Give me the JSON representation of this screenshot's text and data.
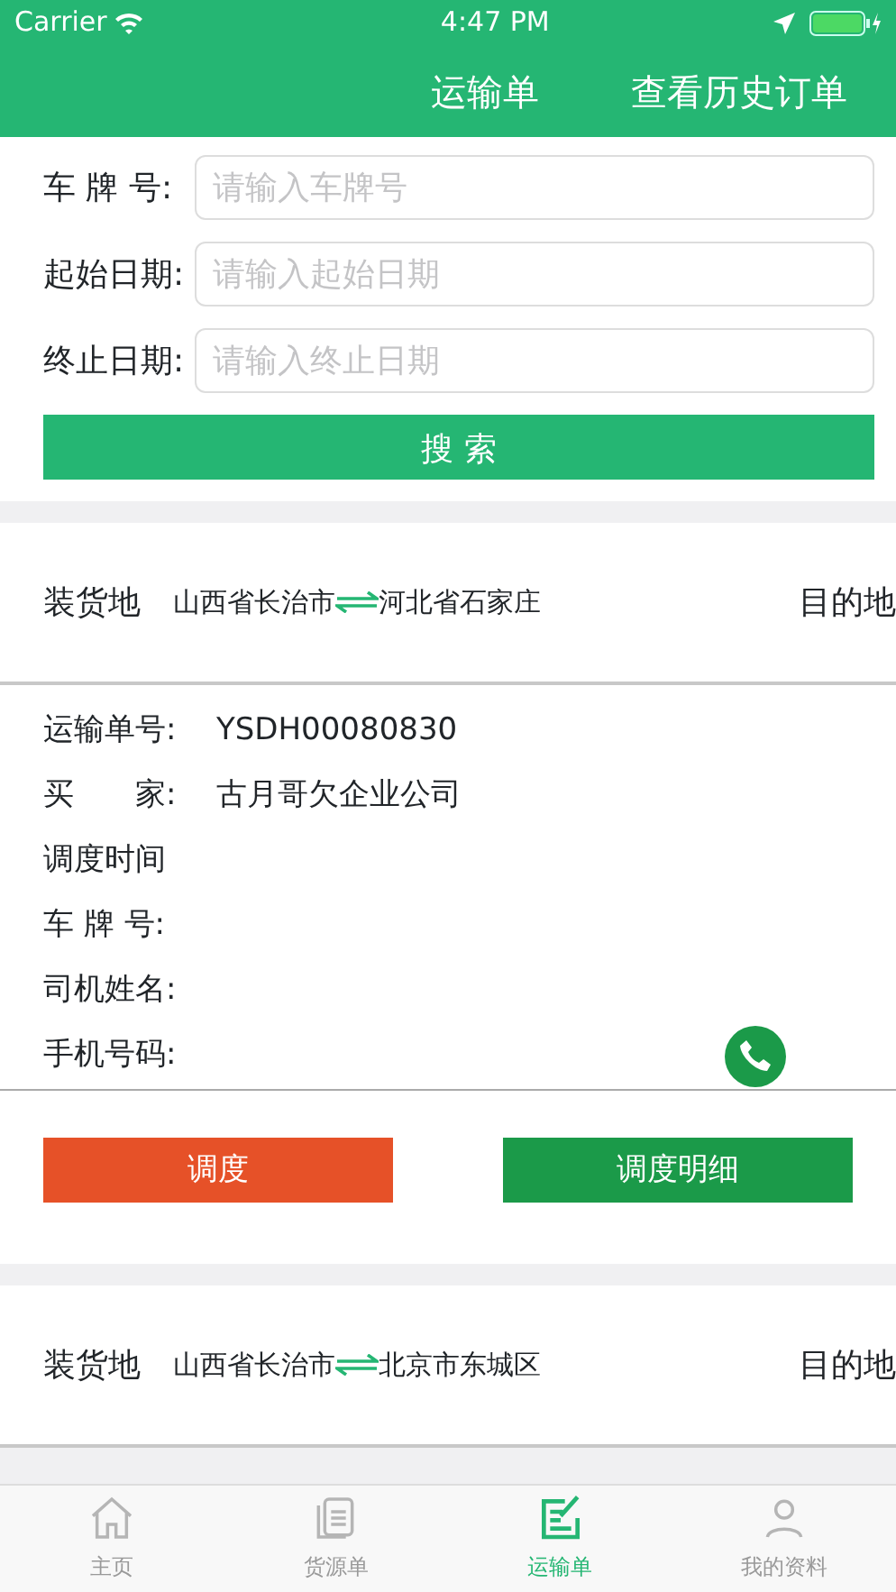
{
  "status_bar": {
    "carrier": "Carrier",
    "time": "4:47 PM"
  },
  "nav": {
    "title": "运输单",
    "action": "查看历史订单"
  },
  "form": {
    "fields": [
      {
        "label": "车 牌 号:",
        "placeholder": "请输入车牌号"
      },
      {
        "label": "起始日期:",
        "placeholder": "请输入起始日期"
      },
      {
        "label": "终止日期:",
        "placeholder": "请输入终止日期"
      }
    ],
    "search_button": "搜 索"
  },
  "orders": [
    {
      "origin_label": "装货地",
      "route_from": "山西省长治市",
      "route_to": "河北省石家庄",
      "dest_label": "目的地",
      "details": [
        {
          "kind": "text",
          "label": "运输单号:",
          "value": "YSDH00080830"
        },
        {
          "kind": "text",
          "label": "买　　家:",
          "value": "古月哥欠企业公司"
        },
        {
          "kind": "text",
          "label": "调度时间"
        },
        {
          "kind": "text",
          "label": "车 牌 号:"
        },
        {
          "kind": "text",
          "label": "司机姓名:"
        },
        {
          "kind": "phone",
          "label": "手机号码:"
        }
      ],
      "buttons": [
        {
          "label": "调度",
          "color": "#e65128"
        },
        {
          "label": "调度明细",
          "color": "#1b9a49"
        }
      ]
    },
    {
      "origin_label": "装货地",
      "route_from": "山西省长治市",
      "route_to": "北京市东城区",
      "dest_label": "目的地"
    }
  ],
  "tab_bar": [
    {
      "label": "主页",
      "selected": false
    },
    {
      "label": "货源单",
      "selected": false
    },
    {
      "label": "运输单",
      "selected": true
    },
    {
      "label": "我的资料",
      "selected": false
    }
  ]
}
